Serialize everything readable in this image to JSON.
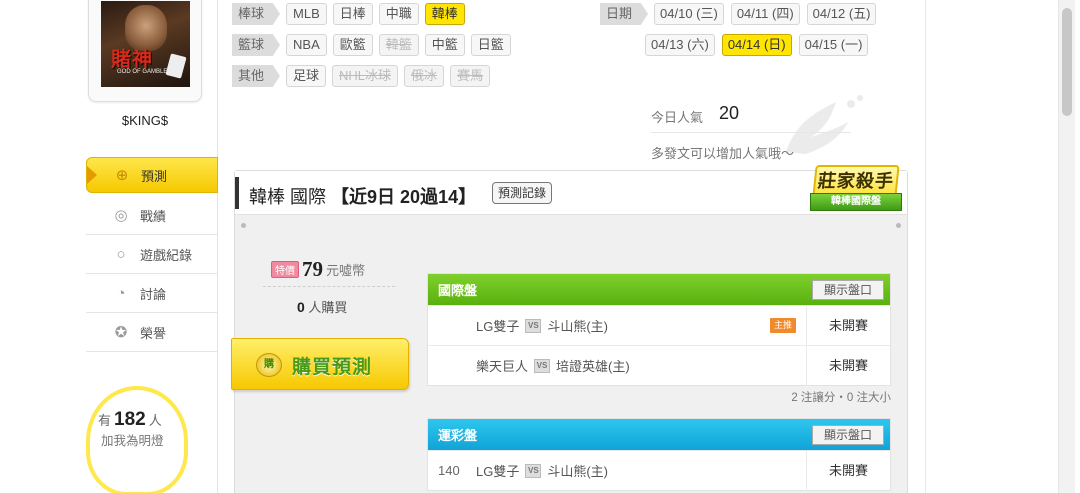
{
  "profile": {
    "poster_title": "賭神",
    "poster_subtitle": "GOD OF GAMBLERS",
    "username": "$KING$"
  },
  "nav": {
    "items": [
      {
        "label": "預測",
        "icon": "target-icon",
        "active": true
      },
      {
        "label": "戰績",
        "icon": "chart-icon",
        "active": false
      },
      {
        "label": "遊戲紀錄",
        "icon": "record-icon",
        "active": false
      },
      {
        "label": "討論",
        "icon": "discussion-icon",
        "active": false
      },
      {
        "label": "榮譽",
        "icon": "medal-icon",
        "active": false
      }
    ]
  },
  "fans": {
    "prefix": "有",
    "count": "182",
    "suffix": "人",
    "line2": "加我為明燈"
  },
  "filters": {
    "baseball": {
      "label": "棒球",
      "options": [
        "MLB",
        "日棒",
        "中職",
        "韓棒"
      ],
      "selected": "韓棒"
    },
    "basketball": {
      "label": "籃球",
      "options": [
        "NBA",
        "歐籃",
        "韓籃",
        "中籃",
        "日籃"
      ],
      "disabled": [
        "韓籃"
      ]
    },
    "other": {
      "label": "其他",
      "options": [
        "足球",
        "NHL冰球",
        "俄冰",
        "賽馬"
      ],
      "disabled": [
        "NHL冰球",
        "俄冰",
        "賽馬"
      ]
    }
  },
  "dates": {
    "label": "日期",
    "row1": [
      "04/10 (三)",
      "04/11 (四)",
      "04/12 (五)"
    ],
    "row2": [
      "04/13 (六)",
      "04/14 (日)",
      "04/15 (一)"
    ],
    "selected": "04/14 (日)"
  },
  "popularity": {
    "label": "今日人氣",
    "value": "20",
    "hint": "多發文可以增加人氣哦～"
  },
  "panel": {
    "title_prefix": "韓棒 國際",
    "title_stats": "【近9日 20過14】",
    "record_button": "預測記錄",
    "badge_main": "莊家殺手",
    "badge_sub": "韓棒國際盤"
  },
  "purchase": {
    "special_tag": "特價",
    "price": "79",
    "unit": "元噓幣",
    "buyers_count": "0",
    "buyers_label": "人購買",
    "buy_icon_text": "購",
    "buy_button": "購買預測"
  },
  "international": {
    "title": "國際盤",
    "show_button": "顯示盤口",
    "rows": [
      {
        "num": "",
        "away": "LG雙子",
        "home": "斗山熊(主)",
        "tag": "主推",
        "status": "未開賽"
      },
      {
        "num": "",
        "away": "樂天巨人",
        "home": "培證英雄(主)",
        "tag": "",
        "status": "未開賽"
      }
    ],
    "note": "2 注讓分・0 注大小"
  },
  "lottery": {
    "title": "運彩盤",
    "show_button": "顯示盤口",
    "rows": [
      {
        "num": "140",
        "away": "LG雙子",
        "home": "斗山熊(主)",
        "status": "未開賽"
      }
    ]
  },
  "vs_label": "VS",
  "colors": {
    "accent_yellow": "#ffe500",
    "green_header": "#59b00e",
    "blue_header": "#10a4d6"
  }
}
